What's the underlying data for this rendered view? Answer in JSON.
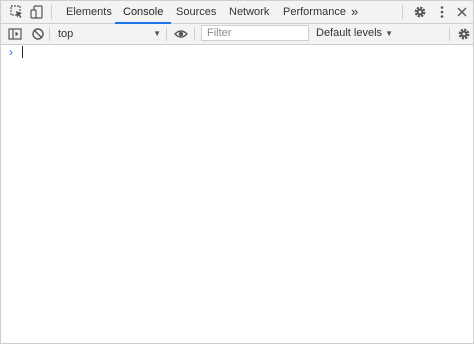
{
  "tabs": [
    {
      "label": "Elements",
      "active": false
    },
    {
      "label": "Console",
      "active": true
    },
    {
      "label": "Sources",
      "active": false
    },
    {
      "label": "Network",
      "active": false
    },
    {
      "label": "Performance",
      "active": false
    }
  ],
  "tabbar": {
    "overflow_label": "»",
    "icons": [
      "inspect-element-icon",
      "device-toolbar-icon",
      "gear-icon",
      "kebab-menu-icon",
      "close-icon"
    ]
  },
  "toolbar": {
    "context": "top",
    "filter_placeholder": "Filter",
    "filter_value": "",
    "levels_label": "Default levels",
    "icons": [
      "sidebar-toggle-icon",
      "clear-console-icon",
      "eye-icon",
      "gear-icon"
    ]
  },
  "console": {
    "prompt_symbol": "›",
    "input_value": ""
  },
  "colors": {
    "accent": "#1a73e8",
    "toolbar_bg": "#f3f3f3",
    "border": "#cfcfcf"
  }
}
